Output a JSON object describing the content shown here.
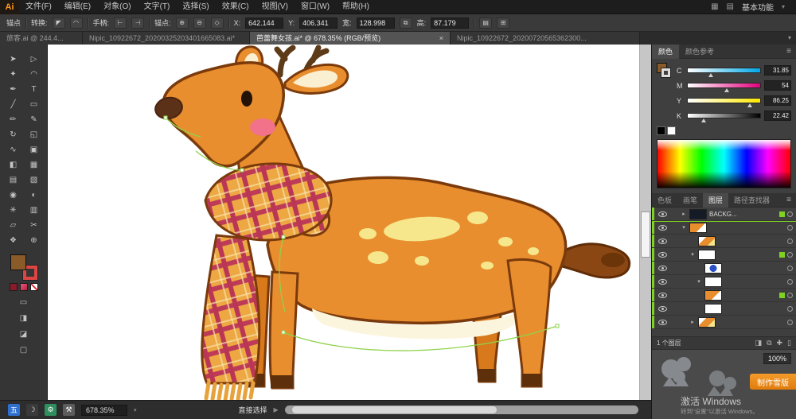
{
  "titlebar": {
    "logo": "Ai",
    "menus": [
      "文件(F)",
      "编辑(E)",
      "对象(O)",
      "文字(T)",
      "选择(S)",
      "效果(C)",
      "视图(V)",
      "窗口(W)",
      "帮助(H)"
    ],
    "icons": [
      "▦",
      "▤"
    ],
    "workspace": "基本功能",
    "workspace_caret": "▾"
  },
  "controlbar": {
    "title": "锚点",
    "convert_label": "转换:",
    "convert_icons": [
      "◤",
      "◠"
    ],
    "handles_label": "手柄:",
    "handles_icons": [
      "⊢",
      "⊣"
    ],
    "anchor_label": "锚点:",
    "anchor_icons": [
      "⊕",
      "⊖",
      "◇"
    ],
    "x_label": "X:",
    "x_value": "642.144",
    "y_label": "Y:",
    "y_value": "406.341",
    "w_label": "宽:",
    "w_value": "128.998",
    "h_label": "高:",
    "h_value": "87.179",
    "link_icon": "⧉",
    "more_icons": [
      "▤",
      "⊞"
    ]
  },
  "tabs": [
    {
      "label": "旅客.ai @ 244.4..."
    },
    {
      "label": "Nipic_10922672_20200325203401665083.ai*"
    },
    {
      "label": "芭蕾舞女孩.ai* @ 678.35% (RGB/预览)",
      "close": "×"
    },
    {
      "label": "Nipic_10922672_20200720565362300..."
    }
  ],
  "tabs_overflow": "▾",
  "tools": [
    {
      "name": "selection",
      "glyph": "➤"
    },
    {
      "name": "direct-selection",
      "glyph": "▷"
    },
    {
      "name": "magic-wand",
      "glyph": "✦"
    },
    {
      "name": "lasso",
      "glyph": "◠"
    },
    {
      "name": "pen",
      "glyph": "✒"
    },
    {
      "name": "type",
      "glyph": "T"
    },
    {
      "name": "line-segment",
      "glyph": "╱"
    },
    {
      "name": "rectangle",
      "glyph": "▭"
    },
    {
      "name": "paintbrush",
      "glyph": "✏"
    },
    {
      "name": "pencil",
      "glyph": "✎"
    },
    {
      "name": "rotate",
      "glyph": "↻"
    },
    {
      "name": "scale",
      "glyph": "◱"
    },
    {
      "name": "width",
      "glyph": "∿"
    },
    {
      "name": "free-transform",
      "glyph": "▣"
    },
    {
      "name": "shape-builder",
      "glyph": "◧"
    },
    {
      "name": "perspective-grid",
      "glyph": "▦"
    },
    {
      "name": "mesh",
      "glyph": "▤"
    },
    {
      "name": "gradient",
      "glyph": "▧"
    },
    {
      "name": "eyedropper",
      "glyph": "◉"
    },
    {
      "name": "blend",
      "glyph": "◐"
    },
    {
      "name": "symbol-sprayer",
      "glyph": "✳"
    },
    {
      "name": "column-graph",
      "glyph": "▥"
    },
    {
      "name": "artboard",
      "glyph": "▱"
    },
    {
      "name": "slice",
      "glyph": "✂"
    },
    {
      "name": "hand",
      "glyph": "❖"
    },
    {
      "name": "zoom",
      "glyph": "⊕"
    }
  ],
  "toolbar_extra": [
    "▭",
    "◨",
    "◪",
    "▢"
  ],
  "color_panel": {
    "tab_color": "颜色",
    "tab_guide": "颜色参考",
    "menu_icon": "≡",
    "channels": [
      {
        "label": "C",
        "value": "31.85"
      },
      {
        "label": "M",
        "value": "54"
      },
      {
        "label": "Y",
        "value": "86.25"
      },
      {
        "label": "K",
        "value": "22.42"
      }
    ]
  },
  "panel_tabs": [
    "色板",
    "画笔",
    "图层",
    "路径查找器"
  ],
  "panel2_menu_icon": "≡",
  "layers": {
    "rows": [
      {
        "name": "BACKG...",
        "disc": "▸"
      },
      {
        "name": "",
        "disc": "▾"
      },
      {
        "name": "",
        "disc": ""
      },
      {
        "name": "",
        "disc": "▾"
      },
      {
        "name": "",
        "disc": ""
      },
      {
        "name": "",
        "disc": "▾"
      },
      {
        "name": "",
        "disc": ""
      },
      {
        "name": "",
        "disc": ""
      },
      {
        "name": "",
        "disc": "▸"
      }
    ],
    "footer": "1 个图层",
    "footer_icons": [
      "◨",
      "⧉",
      "✚",
      "▯"
    ]
  },
  "overlay": {
    "zoom_badge": "100%",
    "snow_button": "制作雪版",
    "activate_line1": "激活 Windows",
    "activate_line2": "转到\"设置\"以激活 Windows。"
  },
  "statusbar": {
    "ime_icons": [
      "五",
      "☽",
      "⚙",
      "⚒"
    ],
    "zoom": "678.35%",
    "zoom_caret": "▾",
    "tool": "直接选择",
    "arrow": "▶"
  },
  "palette": {
    "deer_body": "#E98E2E",
    "deer_outline": "#7A3A0C",
    "scarf_base": "#EDA743",
    "scarf_stripe": "#BE3B58",
    "spots": "#F6E78C",
    "belly": "#FCF5DE",
    "nose": "#5B3118",
    "cheek": "#F2728A",
    "selection_path_green": "#8FD24A",
    "layers_highlight_green": "#7ED321",
    "button_orange": "#E8891D"
  }
}
